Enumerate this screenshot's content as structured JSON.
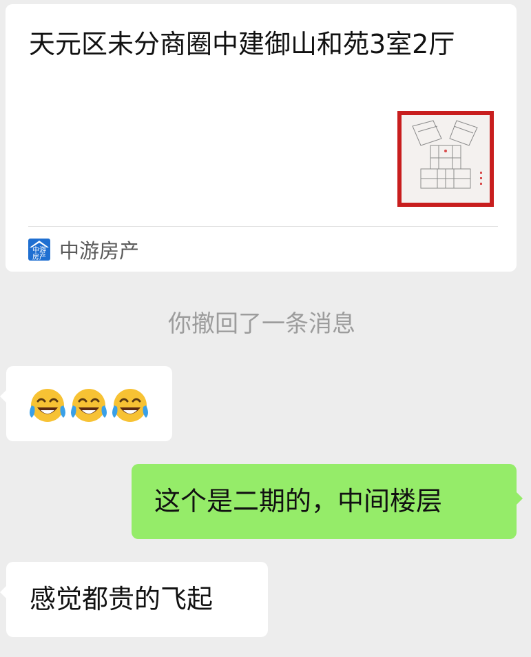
{
  "link_card": {
    "title": "天元区未分商圈中建御山和苑3室2厅",
    "thumbnail_icon": "floor-plan-thumbnail",
    "source": {
      "icon": "zhongyou-property-logo",
      "logo_text_top": "中游",
      "logo_text_bottom": "房产",
      "name": "中游房产"
    }
  },
  "system_message": "你撤回了一条消息",
  "messages": [
    {
      "side": "left",
      "type": "emoji",
      "emojis": [
        "tears-of-joy-icon",
        "tears-of-joy-icon",
        "tears-of-joy-icon"
      ]
    },
    {
      "side": "right",
      "type": "text",
      "text": "这个是二期的，中间楼层"
    },
    {
      "side": "left",
      "type": "text",
      "text": "感觉都贵的飞起"
    }
  ],
  "colors": {
    "background": "#ededed",
    "bubble_self": "#95ec69",
    "bubble_other": "#ffffff",
    "system_text": "#9c9c9c",
    "logo_blue": "#1f6fd1"
  }
}
